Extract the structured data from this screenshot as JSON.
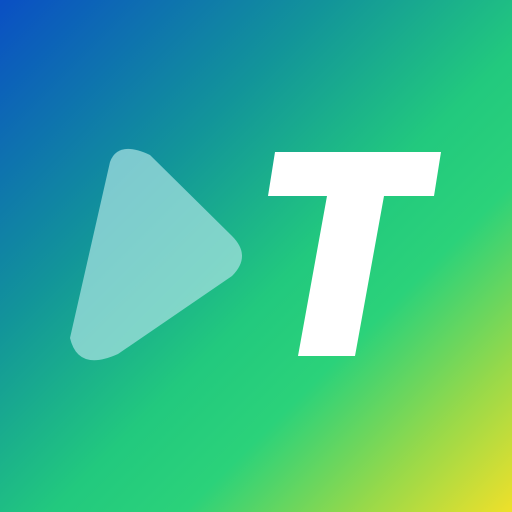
{
  "icon": {
    "name": "app-icon",
    "background_gradient": [
      "#0a4fc4",
      "#12949a",
      "#22c97e",
      "#2bd27a",
      "#97d94a",
      "#efe02a"
    ],
    "play_symbol": "play-icon",
    "letter_symbol": "letter-t-icon",
    "play_fill": "#a8e2e2",
    "play_opacity": 0.72,
    "letter_fill": "#ffffff"
  }
}
